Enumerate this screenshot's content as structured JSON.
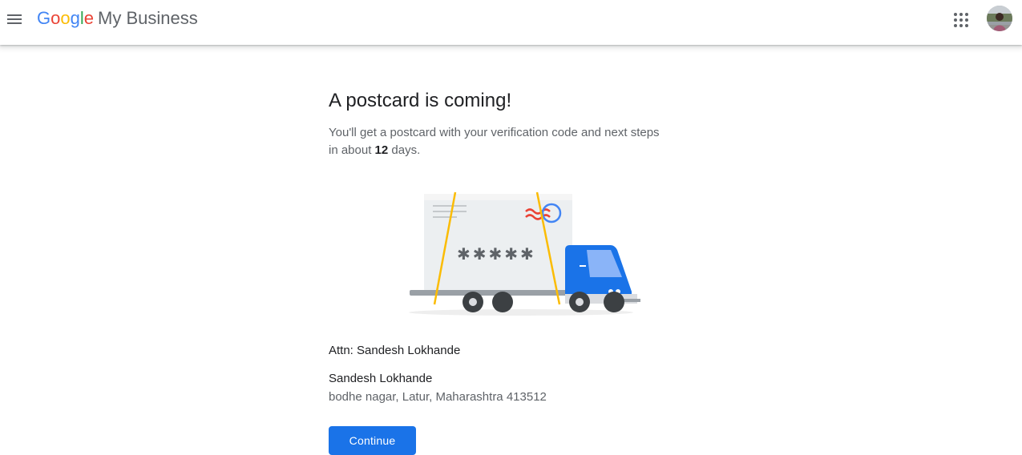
{
  "header": {
    "brand": {
      "letters": [
        {
          "ch": "G",
          "color": "#4285F4"
        },
        {
          "ch": "o",
          "color": "#EA4335"
        },
        {
          "ch": "o",
          "color": "#FBBC05"
        },
        {
          "ch": "g",
          "color": "#4285F4"
        },
        {
          "ch": "l",
          "color": "#34A853"
        },
        {
          "ch": "e",
          "color": "#EA4335"
        }
      ],
      "product": "My Business"
    },
    "menu_icon": "hamburger-menu-icon",
    "apps_icon": "apps-grid-icon",
    "avatar_icon": "account-avatar"
  },
  "main": {
    "title": "A postcard is coming!",
    "description_before": "You'll get a postcard with your verification code and next steps in about ",
    "days": "12",
    "description_after": " days.",
    "illustration": {
      "icon": "delivery-truck-postcard-illustration",
      "code_mask": "✱✱✱✱✱"
    },
    "attn": "Attn: Sandesh Lokhande",
    "recipient_name": "Sandesh Lokhande",
    "address": "bodhe nagar, Latur, Maharashtra 413512",
    "continue_label": "Continue"
  },
  "colors": {
    "accent": "#1a73e8",
    "text_primary": "#202124",
    "text_secondary": "#5f6368"
  }
}
